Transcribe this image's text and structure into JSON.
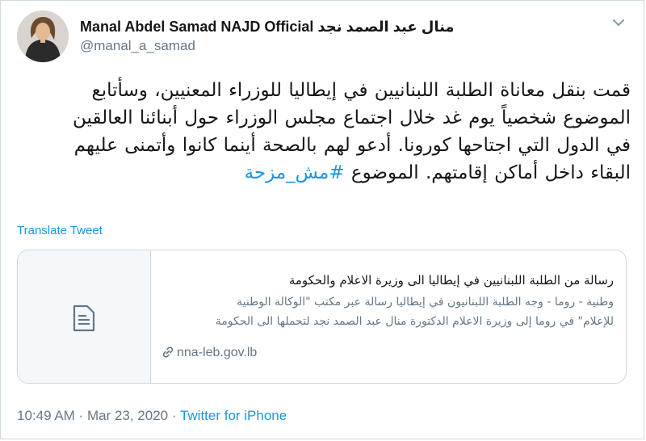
{
  "author": {
    "display_name": "Manal Abdel Samad NAJD Official منال عبد الصمد نجد",
    "handle": "@manal_a_samad"
  },
  "tweet": {
    "lines": [
      "قمت بنقل معاناة الطلبة اللبنانيين في إيطاليا للوزراء المعنيين، وسأتابع",
      "الموضوع شخصياً يوم غد خلال اجتماع مجلس الوزراء حول أبنائنا العالقين",
      "في الدول التي اجتاحها كورونا. أدعو لهم بالصحة أينما كانوا وأتمنى عليهم",
      "البقاء داخل أماكن إقامتهم. الموضوع "
    ],
    "hashtag": "#مش_مزحة"
  },
  "translate_label": "Translate Tweet",
  "card": {
    "title": "رسالة من الطلبة اللبنانيين في إيطاليا الى وزيرة الاعلام والحكومة",
    "description_lines": [
      "وطنية - روما - وجه الطلبة اللبنانيون في إيطاليا رسالة عبر مكتب \"الوكالة الوطنية",
      "للإعلام\" في روما إلى وزيرة الاعلام الدكتورة منال عبد الصمد نجد لتحملها الى الحكومة"
    ],
    "domain": "nna-leb.gov.lb"
  },
  "meta": {
    "time": "10:49 AM",
    "separator": " · ",
    "date": "Mar 23, 2020",
    "separator2": " · ",
    "source": "Twitter for iPhone"
  },
  "icons": {
    "avatar": "profile-photo",
    "menu": "chevron-down-icon",
    "card_thumb": "document-icon",
    "link": "link-icon"
  },
  "colors": {
    "accent": "#1b95e0",
    "secondary_text": "#657786",
    "border": "#ccd6dd"
  }
}
